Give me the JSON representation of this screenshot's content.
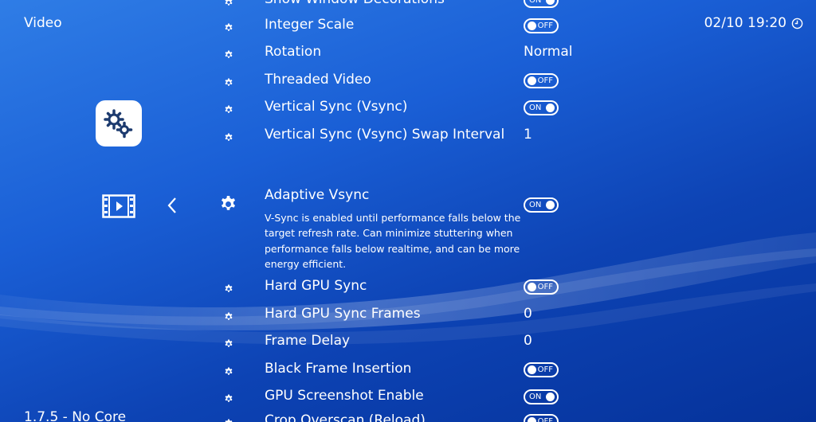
{
  "header": {
    "title": "Video",
    "clock": "02/10 19:20"
  },
  "footer": {
    "version": "1.7.5 - No Core"
  },
  "icons": {
    "tab": "settings-icon",
    "submenu": "film-icon",
    "back": "chevron-left-icon",
    "item": "gear-icon",
    "clock": "clock-icon"
  },
  "menu": {
    "above": [
      {
        "label": "Show Window Decorations",
        "type": "toggle",
        "state": "ON"
      },
      {
        "label": "Integer Scale",
        "type": "toggle",
        "state": "OFF"
      },
      {
        "label": "Rotation",
        "type": "value",
        "value": "Normal"
      },
      {
        "label": "Threaded Video",
        "type": "toggle",
        "state": "OFF"
      },
      {
        "label": "Vertical Sync (Vsync)",
        "type": "toggle",
        "state": "ON"
      },
      {
        "label": "Vertical Sync (Vsync) Swap Interval",
        "type": "value",
        "value": "1"
      }
    ],
    "selected": {
      "label": "Adaptive Vsync",
      "state": "ON",
      "description": "V-Sync is enabled until performance falls below the target refresh rate. Can minimize stuttering when performance falls below realtime, and can be more energy efficient."
    },
    "below": [
      {
        "label": "Hard GPU Sync",
        "type": "toggle",
        "state": "OFF"
      },
      {
        "label": "Hard GPU Sync Frames",
        "type": "value",
        "value": "0"
      },
      {
        "label": "Frame Delay",
        "type": "value",
        "value": "0"
      },
      {
        "label": "Black Frame Insertion",
        "type": "toggle",
        "state": "OFF"
      },
      {
        "label": "GPU Screenshot Enable",
        "type": "toggle",
        "state": "ON"
      },
      {
        "label": "Crop Overscan (Reload)",
        "type": "toggle",
        "state": "OFF"
      }
    ]
  },
  "colors": {
    "background_top": "#2f7de6",
    "background_bottom": "#05329a",
    "text": "#ffffff"
  }
}
